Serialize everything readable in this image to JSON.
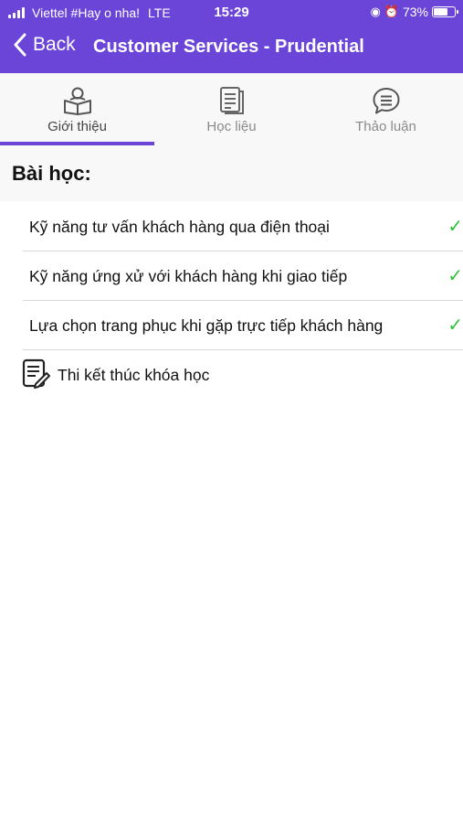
{
  "status_bar": {
    "carrier": "Viettel #Hay o nha!",
    "network": "LTE",
    "time": "15:29",
    "battery": "73%",
    "battery_level": 0.73
  },
  "nav": {
    "back_label": "Back",
    "title": "Customer Services - Prudential"
  },
  "tabs": [
    {
      "label": "Giới thiệu",
      "icon": "reading-person-icon",
      "active": true
    },
    {
      "label": "Học liệu",
      "icon": "document-icon",
      "active": false
    },
    {
      "label": "Thảo luận",
      "icon": "chat-bubble-icon",
      "active": false
    }
  ],
  "section": {
    "title": "Bài học:"
  },
  "lessons": [
    {
      "label": "Kỹ năng tư vấn khách hàng qua điện thoại",
      "completed": true
    },
    {
      "label": "Kỹ năng ứng xử với khách hàng khi giao tiếp",
      "completed": true
    },
    {
      "label": "Lựa chọn trang phục khi gặp trực tiếp khách hàng",
      "completed": true
    }
  ],
  "exam": {
    "label": "Thi kết thúc khóa học",
    "icon": "exam-edit-icon"
  },
  "colors": {
    "accent": "#6a45d8",
    "check": "#2fbf3a"
  }
}
